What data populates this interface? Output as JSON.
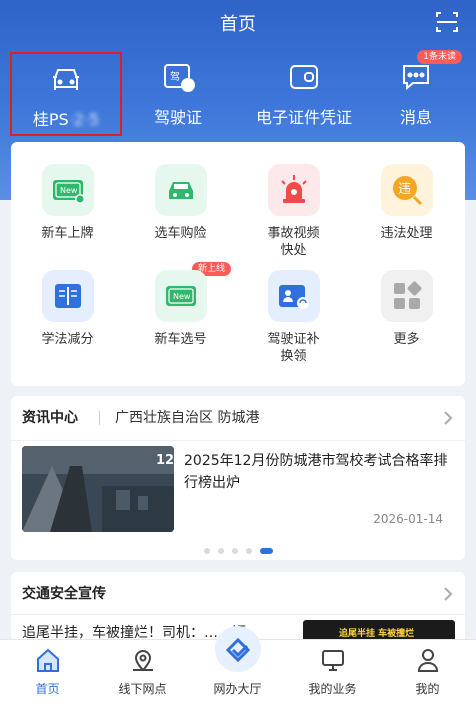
{
  "header": {
    "title": "首页",
    "scan_icon": "scan-icon"
  },
  "quick_actions": [
    {
      "label_prefix": "桂PS",
      "label_blurred": "·2·5",
      "icon": "car-icon"
    },
    {
      "label": "驾驶证",
      "icon": "license-card-icon",
      "icon_text": "驾"
    },
    {
      "label": "电子证件凭证",
      "icon": "wallet-icon"
    },
    {
      "label": "消息",
      "icon": "message-icon",
      "badge": "1条未读"
    }
  ],
  "services": [
    {
      "label": "新车上牌",
      "icon": "new-plate-icon",
      "icon_text": "New"
    },
    {
      "label": "选车购险",
      "icon": "car-insurance-icon"
    },
    {
      "label": "事故视频快处",
      "line1": "事故视频",
      "line2": "快处",
      "icon": "alarm-light-icon"
    },
    {
      "label": "违法处理",
      "icon": "violation-icon",
      "icon_text": "违"
    },
    {
      "label": "学法减分",
      "icon": "book-icon"
    },
    {
      "label": "新车选号",
      "icon": "plate-select-icon",
      "icon_text": "New",
      "tag": "新上线"
    },
    {
      "label": "驾驶证补换领",
      "line1": "驾驶证补",
      "line2": "换领",
      "icon": "license-renew-icon"
    },
    {
      "label": "更多",
      "icon": "more-grid-icon"
    }
  ],
  "news": {
    "section_title": "资讯中心",
    "region": "广西壮族自治区 防城港",
    "article_title": "2025年12月份防城港市驾校考试合格率排行榜出炉",
    "date": "2026-01-14",
    "thumb_text": "12",
    "dots": 5,
    "active_dot": 4
  },
  "safety": {
    "section_title": "交通安全宣传",
    "article_snippet": "追尾半挂，车被撞烂！司机：……短",
    "thumb_caption": "追尾半挂 车被撞烂"
  },
  "tabbar": [
    {
      "label": "首页",
      "icon": "home-icon",
      "active": true
    },
    {
      "label": "线下网点",
      "icon": "location-icon"
    },
    {
      "label": "网办大厅",
      "icon": "service-hall-icon"
    },
    {
      "label": "我的业务",
      "icon": "monitor-icon"
    },
    {
      "label": "我的",
      "icon": "user-icon"
    }
  ],
  "colors": {
    "brand_blue": "#2f63c8",
    "active_tab": "#2f6fde",
    "badge_red": "#ff5b5b",
    "selection_red": "#e02020"
  }
}
